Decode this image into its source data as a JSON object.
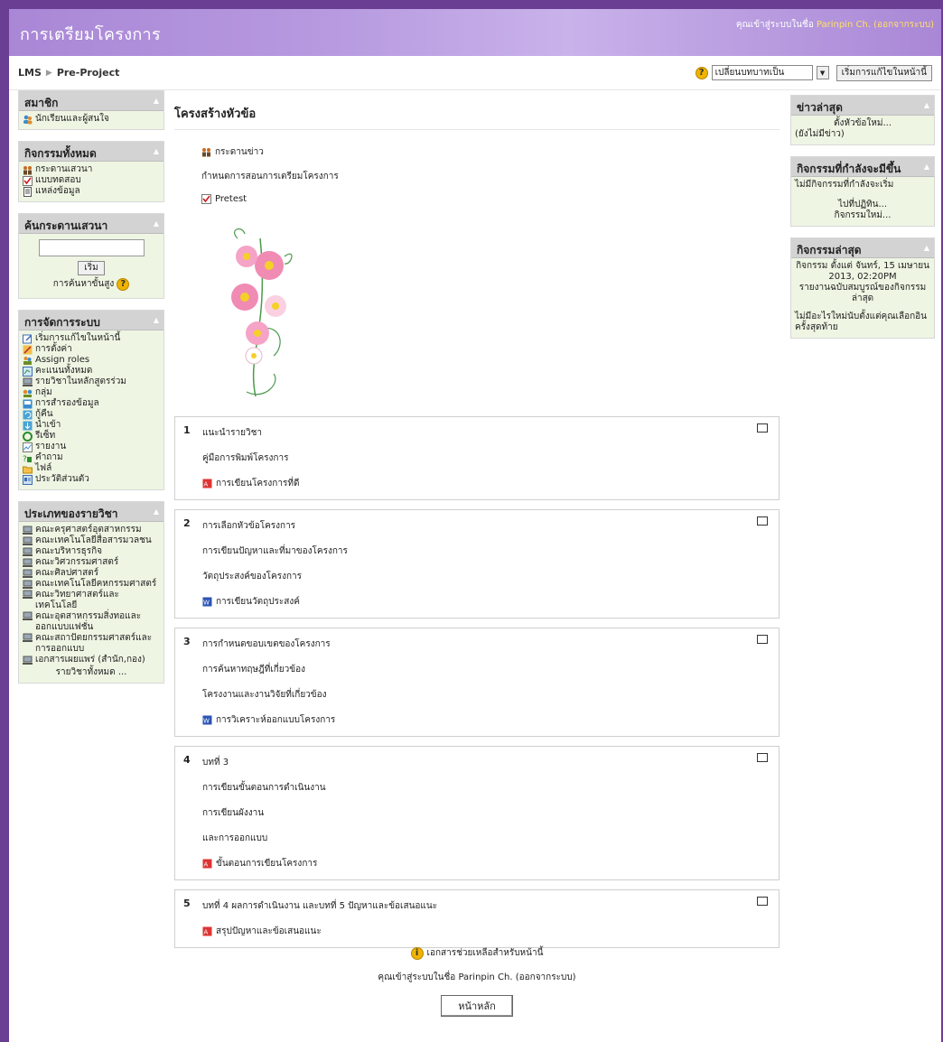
{
  "header": {
    "site_title": "การเตรียมโครงการ",
    "login_prefix": "คุณเข้าสู่ระบบในชื่อ",
    "user_name": "Parinpin Ch.",
    "logout_label": "(ออกจากระบบ)"
  },
  "navbar": {
    "breadcrumb_root": "LMS",
    "breadcrumb_current": "Pre-Project",
    "role_select_value": "เปลี่ยนบทบาทเป็น",
    "edit_button": "เริ่มการแก้ไขในหน้านี้"
  },
  "left": {
    "members": {
      "title": "สมาชิก",
      "items": [
        "นักเรียนและผู้สนใจ"
      ]
    },
    "activities": {
      "title": "กิจกรรมทั้งหมด",
      "items": [
        "กระดานเสวนา",
        "แบบทดสอบ",
        "แหล่งข้อมูล"
      ]
    },
    "search": {
      "title": "ค้นกระดานเสวนา",
      "button": "เริ่ม",
      "advanced": "การค้นหาขั้นสูง"
    },
    "admin": {
      "title": "การจัดการระบบ",
      "items": [
        "เริ่มการแก้ไขในหน้านี้",
        "การตั้งค่า",
        "Assign roles",
        "คะแนนทั้งหมด",
        "รายวิชาในหลักสูตรร่วม",
        "กลุ่ม",
        "การสำรองข้อมูล",
        "กู้คืน",
        "นำเข้า",
        "รีเซ็ท",
        "รายงาน",
        "คำถาม",
        "ไฟล์",
        "ประวัติส่วนตัว"
      ]
    },
    "categories": {
      "title": "ประเภทของรายวิชา",
      "items": [
        "คณะครุศาสตร์อุตสาหกรรม",
        "คณะเทคโนโลยีสื่อสารมวลชน",
        "คณะบริหารธุรกิจ",
        "คณะวิศวกรรมศาสตร์",
        "คณะศิลปศาสตร์",
        "คณะเทคโนโลยีคหกรรมศาสตร์",
        "คณะวิทยาศาสตร์และเทคโนโลยี",
        "คณะอุตสาหกรรมสิ่งทอและออกแบบแฟชั่น",
        "คณะสถาปัตยกรรมศาสตร์และการออกแบบ",
        "เอกสารเผยแพร่ (สำนัก,กอง)"
      ],
      "all_courses": "รายวิชาทั้งหมด ..."
    }
  },
  "main": {
    "title": "โครงสร้างหัวข้อ",
    "intro": {
      "forum": "กระดานข่าว",
      "text": "กำหนดการสอนการเตรียมโครงการ",
      "quiz": "Pretest"
    },
    "sections": [
      {
        "num": "1",
        "lines": [
          "แนะนำรายวิชา",
          "คู่มือการพิมพ์โครงการ"
        ],
        "resource": "การเขียนโครงการที่ดี",
        "type": "pdf"
      },
      {
        "num": "2",
        "lines": [
          "การเลือกหัวข้อโครงการ",
          "การเขียนปัญหาและที่มาของโครงการ",
          "วัตถุประสงค์ของโครงการ"
        ],
        "resource": "การเขียนวัตถุประสงค์",
        "type": "word"
      },
      {
        "num": "3",
        "lines": [
          "การกำหนดขอบเขตของโครงการ",
          "การค้นหาทฤษฎีที่เกี่ยวข้อง",
          "โครงงานและงานวิจัยที่เกี่ยวข้อง"
        ],
        "resource": "การวิเคราะห์ออกแบบโครงการ",
        "type": "word"
      },
      {
        "num": "4",
        "lines": [
          "บทที่ 3",
          "การเขียนขั้นตอนการดำเนินงาน",
          "การเขียนผังงาน",
          "และการออกแบบ"
        ],
        "resource": "ขั้นตอนการเขียนโครงการ",
        "type": "pdf"
      },
      {
        "num": "5",
        "lines": [
          "บทที่ 4 ผลการดำเนินงาน และบทที่ 5 ปัญหาและข้อเสนอแนะ"
        ],
        "resource": "สรุปปัญหาและข้อเสนอแนะ",
        "type": "pdf"
      }
    ]
  },
  "right": {
    "news": {
      "title": "ข่าวล่าสุด",
      "add": "ตั้งหัวข้อใหม่...",
      "empty": "(ยังไม่มีข่าว)"
    },
    "upcoming": {
      "title": "กิจกรรมที่กำลังจะมีขึ้น",
      "none": "ไม่มีกิจกรรมที่กำลังจะเริ่ม",
      "calendar": "ไปที่ปฏิทิน...",
      "new_event": "กิจกรรมใหม่..."
    },
    "recent": {
      "title": "กิจกรรมล่าสุด",
      "since": "กิจกรรม ตั้งแต่ จันทร์, 15 เมษายน 2013, 02:20PM",
      "report": "รายงานฉบับสมบูรณ์ของกิจกรรมล่าสุด",
      "nothing": "ไม่มีอะไรใหม่นับตั้งแต่คุณเลือกอินครั้งสุดท้าย"
    }
  },
  "footer": {
    "help": "เอกสารช่วยเหลือสำหรับหน้านี้",
    "login_text": "คุณเข้าสู่ระบบในชื่อ Parinpin Ch. (ออกจากระบบ)",
    "home_button": "หน้าหลัก"
  }
}
